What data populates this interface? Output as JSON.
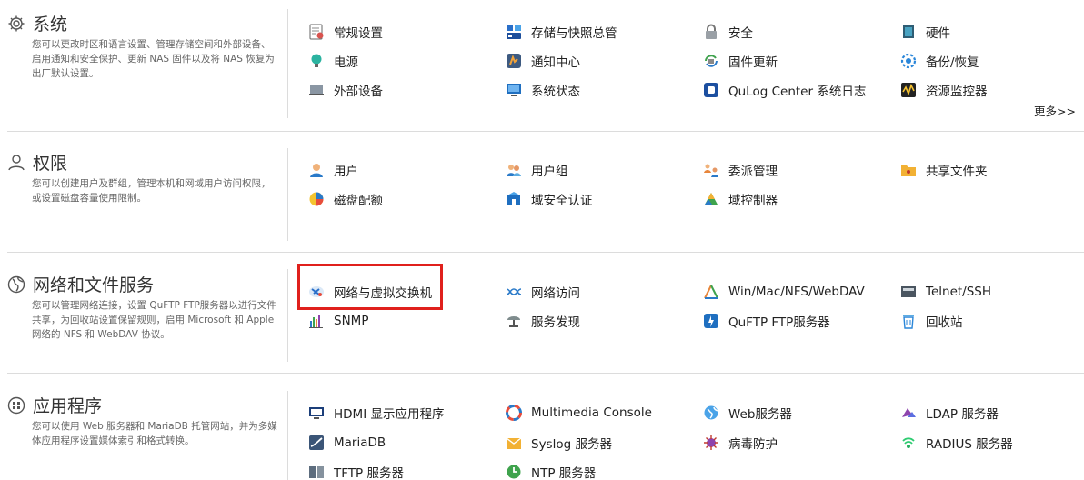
{
  "system": {
    "title": "系统",
    "desc": "您可以更改时区和语言设置、管理存储空间和外部设备、启用通知和安全保护、更新 NAS 固件以及将 NAS 恢复为出厂默认设置。",
    "items": [
      {
        "label": "常规设置",
        "icon": "general-settings-icon"
      },
      {
        "label": "存储与快照总管",
        "icon": "storage-snapshots-icon"
      },
      {
        "label": "安全",
        "icon": "lock-icon"
      },
      {
        "label": "硬件",
        "icon": "hardware-icon"
      },
      {
        "label": "电源",
        "icon": "power-bulb-icon"
      },
      {
        "label": "通知中心",
        "icon": "notification-icon"
      },
      {
        "label": "固件更新",
        "icon": "firmware-update-icon"
      },
      {
        "label": "备份/恢复",
        "icon": "backup-restore-icon"
      },
      {
        "label": "外部设备",
        "icon": "external-device-icon"
      },
      {
        "label": "系统状态",
        "icon": "system-status-icon"
      },
      {
        "label": "QuLog Center 系统日志",
        "icon": "qulog-icon"
      },
      {
        "label": "资源监控器",
        "icon": "resource-monitor-icon"
      }
    ],
    "more": "更多>>"
  },
  "privilege": {
    "title": "权限",
    "desc": "您可以创建用户及群组，管理本机和网域用户访问权限，或设置磁盘容量使用限制。",
    "items": [
      {
        "label": "用户",
        "icon": "user-icon"
      },
      {
        "label": "用户组",
        "icon": "user-group-icon"
      },
      {
        "label": "委派管理",
        "icon": "delegation-icon"
      },
      {
        "label": "共享文件夹",
        "icon": "shared-folder-icon"
      },
      {
        "label": "磁盘配额",
        "icon": "quota-icon"
      },
      {
        "label": "域安全认证",
        "icon": "domain-security-icon"
      },
      {
        "label": "域控制器",
        "icon": "domain-controller-icon"
      }
    ]
  },
  "network": {
    "title": "网络和文件服务",
    "desc": "您可以管理网络连接，设置 QuFTP FTP服务器以进行文件共享，为回收站设置保留规则，启用 Microsoft 和 Apple 网络的 NFS 和 WebDAV 协议。",
    "items": [
      {
        "label": "网络与虚拟交换机",
        "icon": "network-switch-icon"
      },
      {
        "label": "网络访问",
        "icon": "network-access-icon"
      },
      {
        "label": "Win/Mac/NFS/WebDAV",
        "icon": "file-protocol-icon"
      },
      {
        "label": "Telnet/SSH",
        "icon": "terminal-icon"
      },
      {
        "label": "SNMP",
        "icon": "snmp-icon"
      },
      {
        "label": "服务发现",
        "icon": "service-discovery-icon"
      },
      {
        "label": "QuFTP FTP服务器",
        "icon": "ftp-icon"
      },
      {
        "label": "回收站",
        "icon": "recycle-bin-icon"
      }
    ]
  },
  "apps": {
    "title": "应用程序",
    "desc": "您可以使用 Web 服务器和 MariaDB 托管网站，并为多媒体应用程序设置媒体索引和格式转换。",
    "items": [
      {
        "label": "HDMI 显示应用程序",
        "icon": "hdmi-icon"
      },
      {
        "label": "Multimedia Console",
        "icon": "multimedia-icon"
      },
      {
        "label": "Web服务器",
        "icon": "web-server-icon"
      },
      {
        "label": "LDAP 服务器",
        "icon": "ldap-icon"
      },
      {
        "label": "MariaDB",
        "icon": "mariadb-icon"
      },
      {
        "label": "Syslog 服务器",
        "icon": "syslog-icon"
      },
      {
        "label": "病毒防护",
        "icon": "antivirus-icon"
      },
      {
        "label": "RADIUS 服务器",
        "icon": "radius-icon"
      },
      {
        "label": "TFTP 服务器",
        "icon": "tftp-icon"
      },
      {
        "label": "NTP 服务器",
        "icon": "ntp-icon"
      }
    ]
  }
}
